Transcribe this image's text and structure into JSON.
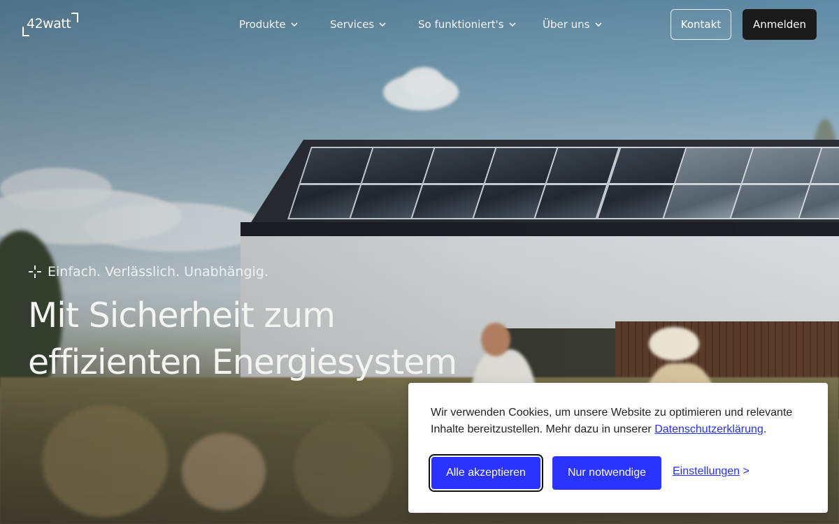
{
  "brand": {
    "logo_text": "42watt"
  },
  "nav": {
    "items": [
      {
        "label": "Produkte"
      },
      {
        "label": "Services"
      },
      {
        "label": "So funktioniert's"
      },
      {
        "label": "Über uns"
      }
    ],
    "contact_label": "Kontakt",
    "login_label": "Anmelden"
  },
  "hero": {
    "tagline": "Einfach. Verlässlich. Unabhängig.",
    "headline_line1": "Mit Sicherheit zum",
    "headline_line2": "effizienten Energiesystem"
  },
  "cookie_banner": {
    "text_before_link": "Wir verwenden Cookies, um unsere Website zu optimieren und relevante Inhalte bereitzustellen. Mehr dazu in unserer ",
    "privacy_link": "Datenschutzerklärung",
    "text_after_link": ".",
    "accept_all_label": "Alle akzeptieren",
    "necessary_label": "Nur notwendige",
    "settings_label": "Einstellungen",
    "settings_arrow": ">"
  },
  "colors": {
    "primary_button": "#2a33ff",
    "link": "#2431f5",
    "login_button_bg": "#1b1b1b"
  },
  "icons": [
    "chevron-down-icon",
    "sparkle-icon",
    "logo-corner-icon"
  ]
}
